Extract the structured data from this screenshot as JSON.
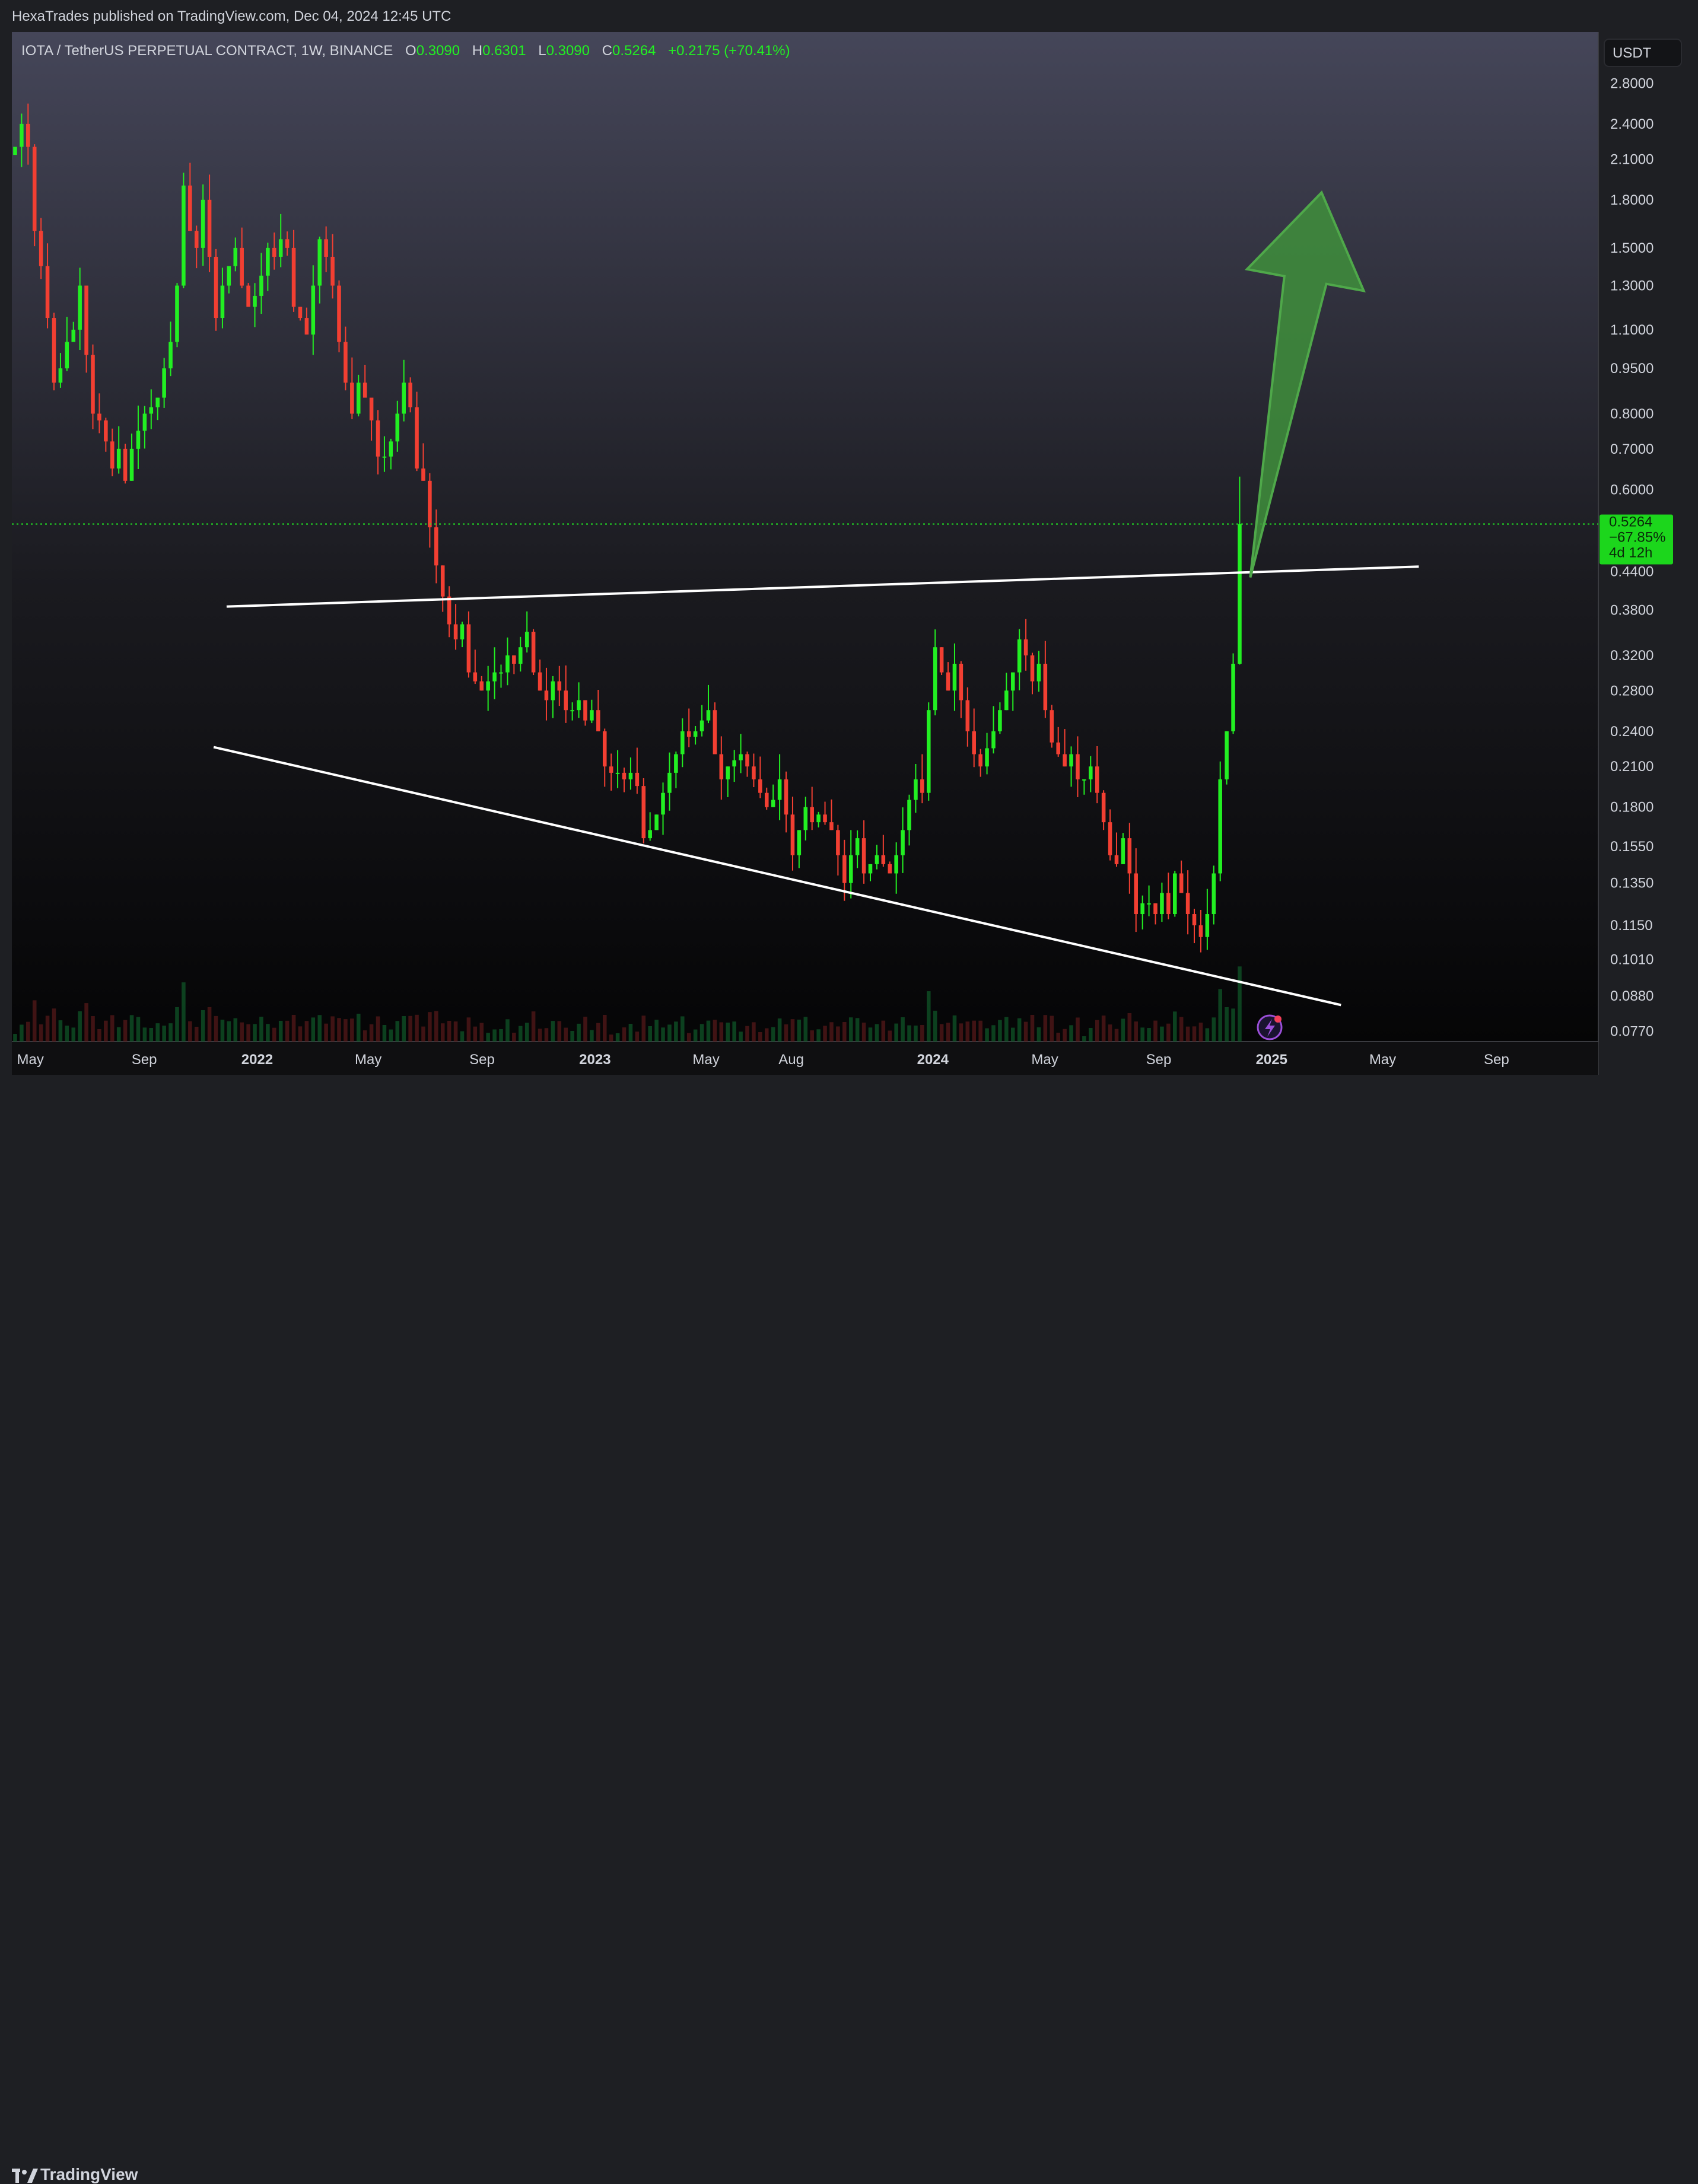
{
  "header": {
    "publish_line": "HexaTrades published on TradingView.com, Dec 04, 2024 12:45 UTC"
  },
  "footer": {
    "brand": "TradingView"
  },
  "colors": {
    "up": "#22ef22",
    "down": "#f23f32",
    "line": "#ffffff",
    "arrow": "#3f8f3c",
    "label_bg": "#1cd61c"
  },
  "chart_data": {
    "type": "candlestick",
    "title": "IOTA / TetherUS PERPETUAL CONTRACT, 1W, BINANCE",
    "ohlc_legend": {
      "o_label": "O",
      "o": "0.3090",
      "h_label": "H",
      "h": "0.6301",
      "l_label": "L",
      "l": "0.3090",
      "c_label": "C",
      "c": "0.5264",
      "change": "+0.2175 (+70.41%)"
    },
    "currency": "USDT",
    "y_scale": "log",
    "y_range": [
      0.074,
      3.4
    ],
    "y_ticks": [
      "2.8000",
      "2.4000",
      "2.1000",
      "1.8000",
      "1.5000",
      "1.3000",
      "1.1000",
      "0.9500",
      "0.8000",
      "0.7000",
      "0.6000",
      "0.4400",
      "0.3800",
      "0.3200",
      "0.2800",
      "0.2400",
      "0.2100",
      "0.1800",
      "0.1550",
      "0.1350",
      "0.1150",
      "0.1010",
      "0.0880",
      "0.0770"
    ],
    "x_labels": [
      "May",
      "Sep",
      "2022",
      "May",
      "Sep",
      "2023",
      "May",
      "Aug",
      "2024",
      "May",
      "Sep",
      "2025",
      "May",
      "Sep"
    ],
    "x_label_dates": [
      "2021-05-01",
      "2021-09-01",
      "2022-01-01",
      "2022-05-01",
      "2022-09-01",
      "2023-01-01",
      "2023-05-01",
      "2023-08-01",
      "2024-01-01",
      "2024-05-01",
      "2024-09-01",
      "2025-01-01",
      "2025-05-01",
      "2025-09-01"
    ],
    "last_price": {
      "price": "0.5264",
      "change": "−67.85%",
      "countdown": "4d 12h"
    },
    "trendlines": [
      {
        "name": "resistance",
        "from": [
          "2021-11-29",
          0.385
        ],
        "to": [
          "2025-06-09",
          0.448
        ]
      },
      {
        "name": "support",
        "from": [
          "2021-11-15",
          0.226
        ],
        "to": [
          "2025-03-17",
          0.085
        ]
      }
    ],
    "annotation": {
      "type": "up-arrow",
      "from": [
        "2024-12-09",
        0.43
      ],
      "to": [
        "2025-02-24",
        1.85
      ]
    },
    "candles_weekly_close": [
      2.2,
      2.4,
      2.2,
      1.6,
      1.4,
      1.15,
      0.9,
      0.95,
      1.05,
      1.1,
      1.3,
      1.0,
      0.8,
      0.78,
      0.72,
      0.65,
      0.7,
      0.62,
      0.7,
      0.75,
      0.8,
      0.82,
      0.85,
      0.95,
      1.05,
      1.3,
      1.9,
      1.6,
      1.5,
      1.8,
      1.45,
      1.15,
      1.3,
      1.4,
      1.5,
      1.3,
      1.2,
      1.25,
      1.35,
      1.5,
      1.45,
      1.55,
      1.5,
      1.2,
      1.15,
      1.08,
      1.3,
      1.55,
      1.45,
      1.3,
      1.05,
      0.9,
      0.8,
      0.9,
      0.85,
      0.78,
      0.68,
      0.68,
      0.72,
      0.8,
      0.9,
      0.82,
      0.65,
      0.62,
      0.52,
      0.45,
      0.4,
      0.36,
      0.34,
      0.36,
      0.3,
      0.29,
      0.28,
      0.29,
      0.3,
      0.3,
      0.32,
      0.31,
      0.33,
      0.35,
      0.3,
      0.28,
      0.27,
      0.29,
      0.28,
      0.26,
      0.26,
      0.27,
      0.25,
      0.26,
      0.24,
      0.21,
      0.205,
      0.205,
      0.2,
      0.205,
      0.195,
      0.16,
      0.165,
      0.175,
      0.19,
      0.205,
      0.22,
      0.24,
      0.235,
      0.24,
      0.25,
      0.26,
      0.22,
      0.2,
      0.21,
      0.215,
      0.22,
      0.21,
      0.2,
      0.19,
      0.18,
      0.185,
      0.2,
      0.175,
      0.15,
      0.165,
      0.18,
      0.17,
      0.175,
      0.17,
      0.165,
      0.15,
      0.135,
      0.15,
      0.16,
      0.14,
      0.145,
      0.15,
      0.145,
      0.14,
      0.15,
      0.165,
      0.185,
      0.2,
      0.19,
      0.26,
      0.33,
      0.3,
      0.28,
      0.31,
      0.27,
      0.24,
      0.22,
      0.21,
      0.225,
      0.24,
      0.26,
      0.28,
      0.3,
      0.34,
      0.32,
      0.29,
      0.31,
      0.26,
      0.23,
      0.22,
      0.21,
      0.22,
      0.2,
      0.2,
      0.21,
      0.19,
      0.17,
      0.15,
      0.145,
      0.16,
      0.14,
      0.12,
      0.125,
      0.125,
      0.12,
      0.13,
      0.12,
      0.14,
      0.13,
      0.12,
      0.115,
      0.11,
      0.12,
      0.14,
      0.2,
      0.24,
      0.31,
      0.5264
    ]
  }
}
